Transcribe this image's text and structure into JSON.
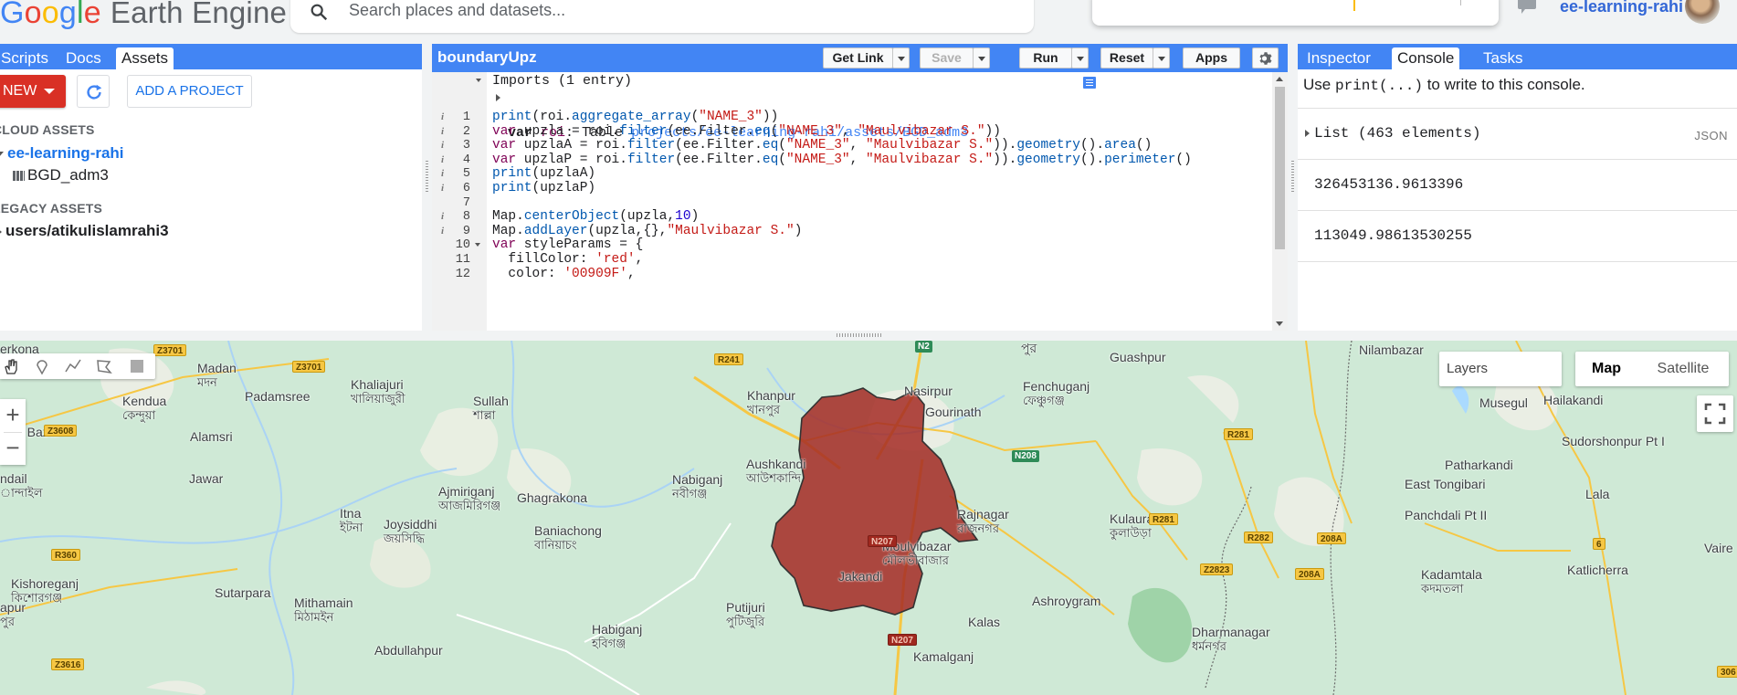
{
  "app": {
    "logo_g": [
      "G",
      "o",
      "o",
      "g",
      "l",
      "e"
    ],
    "logo_suffix": "Earth Engine",
    "search_placeholder": "Search places and datasets...",
    "user": "ee-learning-rahi"
  },
  "left_panel": {
    "tabs": [
      "Scripts",
      "Docs",
      "Assets"
    ],
    "active_tab": "Assets",
    "new_label": "NEW",
    "add_project_label": "ADD A PROJECT",
    "cloud_assets_label": "CLOUD ASSETS",
    "cloud_project": "ee-learning-rahi",
    "cloud_asset": "BGD_adm3",
    "legacy_label": "LEGACY ASSETS",
    "legacy_user": "users/atikulislamrahi3"
  },
  "editor": {
    "title": "boundaryUpz",
    "buttons": {
      "get_link": "Get Link",
      "save": "Save",
      "run": "Run",
      "reset": "Reset",
      "apps": "Apps"
    },
    "imports_label": "Imports (1 entry)",
    "import_line": {
      "kw": "var",
      "name": "roi",
      "type": ": Table ",
      "path": "projects/ee-learning-rahi/assets/BGD_adm3"
    },
    "lines": [
      {
        "n": "1",
        "info": true,
        "code": "print(roi.aggregate_array(\"NAME_3\"))"
      },
      {
        "n": "2",
        "info": true,
        "code": "var upzla = roi.filter(ee.Filter.eq(\"NAME_3\", \"Maulvibazar S.\"))"
      },
      {
        "n": "3",
        "info": true,
        "code": "var upzlaA = roi.filter(ee.Filter.eq(\"NAME_3\", \"Maulvibazar S.\")).geometry().area()"
      },
      {
        "n": "4",
        "info": true,
        "code": "var upzlaP = roi.filter(ee.Filter.eq(\"NAME_3\", \"Maulvibazar S.\")).geometry().perimeter()"
      },
      {
        "n": "5",
        "info": true,
        "code": "print(upzlaA)"
      },
      {
        "n": "6",
        "info": true,
        "code": "print(upzlaP)"
      },
      {
        "n": "7",
        "info": false,
        "code": ""
      },
      {
        "n": "8",
        "info": true,
        "code": "Map.centerObject(upzla,10)"
      },
      {
        "n": "9",
        "info": true,
        "code": "Map.addLayer(upzla,{},\"Maulvibazar S.\")"
      },
      {
        "n": "10",
        "info": false,
        "fold": true,
        "code": "var styleParams = {"
      },
      {
        "n": "11",
        "info": false,
        "code": "  fillColor: 'red',"
      },
      {
        "n": "12",
        "info": false,
        "code": "  color: '00909F',"
      }
    ]
  },
  "right_panel": {
    "tabs": [
      "Inspector",
      "Console",
      "Tasks"
    ],
    "active_tab": "Console",
    "hint_prefix": "Use ",
    "hint_code": "print(...)",
    "hint_suffix": " to write to this console.",
    "outputs": [
      {
        "value": "List (463 elements)",
        "expandable": true,
        "tag": "JSON"
      },
      {
        "value": "326453136.9613396",
        "expandable": false,
        "tag": ""
      },
      {
        "value": "113049.98613530255",
        "expandable": false,
        "tag": ""
      }
    ]
  },
  "map": {
    "layers_label": "Layers",
    "map_label": "Map",
    "satellite_label": "Satellite",
    "zoom_in": "+",
    "zoom_out": "−",
    "polygon_color": "#a52a24",
    "places": [
      {
        "t": "Madan",
        "b": "মদন"
      },
      {
        "t": "Khaliajuri",
        "b": "খালিয়াজুরী"
      },
      {
        "t": "Padamsree",
        "b": ""
      },
      {
        "t": "Kendua",
        "b": "কেন্দুয়া"
      },
      {
        "t": "Sullah",
        "b": "শাল্লা"
      },
      {
        "t": "Alamsri",
        "b": ""
      },
      {
        "t": "a Bazar",
        "b": ""
      },
      {
        "t": "Jawar",
        "b": ""
      },
      {
        "t": "ndail",
        "b": "ান্দাইল"
      },
      {
        "t": "Ajmiriganj",
        "b": "আজমিরিগঞ্জ"
      },
      {
        "t": "Ghagrakona",
        "b": ""
      },
      {
        "t": "Itna",
        "b": "ইটনা"
      },
      {
        "t": "Joysiddhi",
        "b": "জয়সিদ্ধি"
      },
      {
        "t": "Baniachong",
        "b": "বানিয়াচং"
      },
      {
        "t": "Nabiganj",
        "b": "নবীগঞ্জ"
      },
      {
        "t": "Aushkandi",
        "b": "আউশকান্দি"
      },
      {
        "t": "Khanpur",
        "b": "খানপুর"
      },
      {
        "t": "Nasirpur",
        "b": ""
      },
      {
        "t": "Gourinath",
        "b": ""
      },
      {
        "t": "Fenchuganj",
        "b": "ফেঞ্চুগঞ্জ"
      },
      {
        "t": "Guashpur",
        "b": ""
      },
      {
        "t": "Nilambazar",
        "b": ""
      },
      {
        "t": "Balichora",
        "b": ""
      },
      {
        "t": "Musegul",
        "b": ""
      },
      {
        "t": "Hailakandi",
        "b": ""
      },
      {
        "t": "Sudorshonpur Pt I",
        "b": ""
      },
      {
        "t": "Patharkandi",
        "b": ""
      },
      {
        "t": "East Tongibari",
        "b": ""
      },
      {
        "t": "Lala",
        "b": ""
      },
      {
        "t": "Panchdali Pt II",
        "b": ""
      },
      {
        "t": "Rajnagar",
        "b": "রাজনগর"
      },
      {
        "t": "Kulaura",
        "b": "কুলাউড়া"
      },
      {
        "t": "Moulvibazar",
        "b": "মৌলভীবাজার"
      },
      {
        "t": "Jakandi",
        "b": ""
      },
      {
        "t": "Kadamtala",
        "b": "কদমতলা"
      },
      {
        "t": "Katlicherra",
        "b": ""
      },
      {
        "t": "Vaire",
        "b": ""
      },
      {
        "t": "Kishoreganj",
        "b": "কিশোরগঞ্জ"
      },
      {
        "t": "Sutarpara",
        "b": ""
      },
      {
        "t": "Mithamain",
        "b": "মিঠামইন"
      },
      {
        "t": "Putijuri",
        "b": "পুটিজুরি"
      },
      {
        "t": "Habiganj",
        "b": "হবিগঞ্জ"
      },
      {
        "t": "Ashroygram",
        "b": ""
      },
      {
        "t": "Kalas",
        "b": ""
      },
      {
        "t": "Dharmanagar",
        "b": "ধর্মনগর"
      },
      {
        "t": "Abdullahpur",
        "b": ""
      },
      {
        "t": "Kamalganj",
        "b": ""
      },
      {
        "t": "apur",
        "b": "পুর"
      },
      {
        "t": "erkona",
        "b": ""
      },
      {
        "t": "পুর",
        "b": ""
      }
    ],
    "shields": [
      "Z3701",
      "Z3701",
      "Z3608",
      "R360",
      "Z3616",
      "R241",
      "N2",
      "N208",
      "R281",
      "R281",
      "R282",
      "Z2823",
      "208A",
      "208A",
      "6",
      "306",
      "N207",
      "N207"
    ]
  }
}
